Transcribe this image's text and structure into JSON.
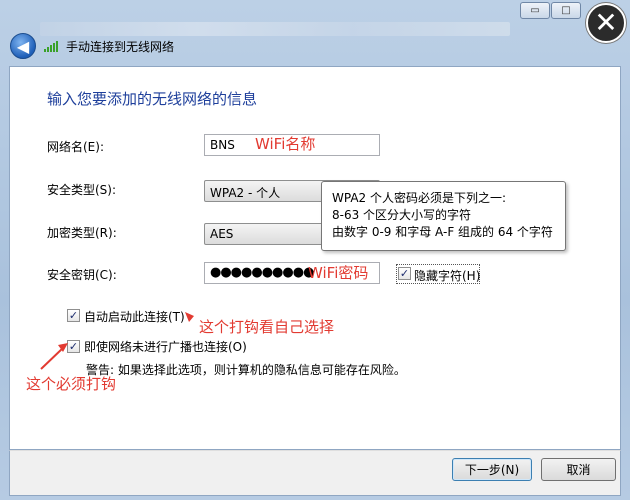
{
  "window": {
    "title": "手动连接到无线网络",
    "controls": {
      "minimize": "▭",
      "maximize": "□",
      "close": "✕"
    }
  },
  "main": {
    "heading": "输入您要添加的无线网络的信息",
    "network_name": {
      "label": "网络名(E):",
      "value": "BNS"
    },
    "security_type": {
      "label": "安全类型(S):",
      "value": "WPA2 - 个人"
    },
    "encryption_type": {
      "label": "加密类型(R):",
      "value": "AES"
    },
    "security_key": {
      "label": "安全密钥(C):",
      "value": "●●●●●●●●●●"
    },
    "hide_chars": {
      "label": "隐藏字符(H)",
      "checked": true
    },
    "tooltip": {
      "line1": "WPA2 个人密码必须是下列之一:",
      "line2": "8-63 个区分大小写的字符",
      "line3": "由数字 0-9 和字母 A-F 组成的 64 个字符"
    },
    "auto_connect": {
      "label": "自动启动此连接(T)",
      "checked": true
    },
    "connect_hidden": {
      "label": "即使网络未进行广播也连接(O)",
      "checked": true
    },
    "warning": "警告: 如果选择此选项，则计算机的隐私信息可能存在风险。"
  },
  "annotations": {
    "wifi_name": "WiFi名称",
    "wifi_password": "WiFi密码",
    "auto_connect_note": "这个打钩看自己选择",
    "hidden_note": "这个必须打钩",
    "color": "#e23a31"
  },
  "footer": {
    "next_label": "下一步(N)",
    "cancel_label": "取消"
  }
}
